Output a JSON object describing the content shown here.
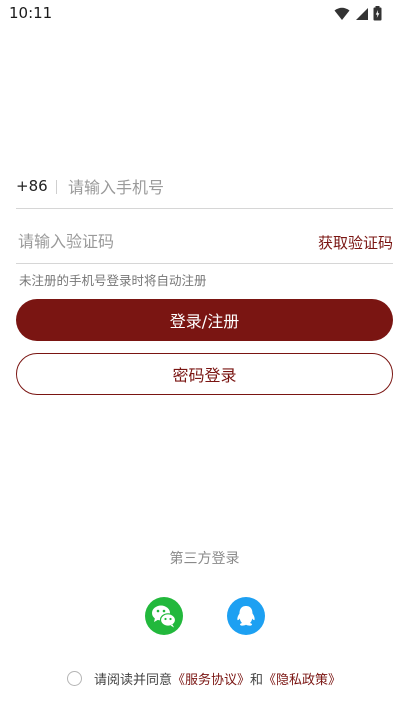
{
  "status_bar": {
    "time": "10:11",
    "icons": [
      "wifi-icon",
      "signal-icon",
      "battery-icon"
    ]
  },
  "login_form": {
    "country_code": "+86",
    "phone_placeholder": "请输入手机号",
    "code_placeholder": "请输入验证码",
    "get_code_label": "获取验证码",
    "hint": "未注册的手机号登录时将自动注册",
    "login_register_label": "登录/注册",
    "password_login_label": "密码登录"
  },
  "third_party": {
    "title": "第三方登录",
    "providers": [
      "wechat-icon",
      "qq-icon"
    ]
  },
  "agreement": {
    "prefix": "请阅读并同意",
    "service_link": "《服务协议》",
    "conjunction": "和",
    "privacy_link": "《隐私政策》",
    "checked": false
  },
  "colors": {
    "accent": "#7a1512",
    "wechat": "#22b83c",
    "qq": "#1da0f2",
    "background": "#ffffff"
  }
}
